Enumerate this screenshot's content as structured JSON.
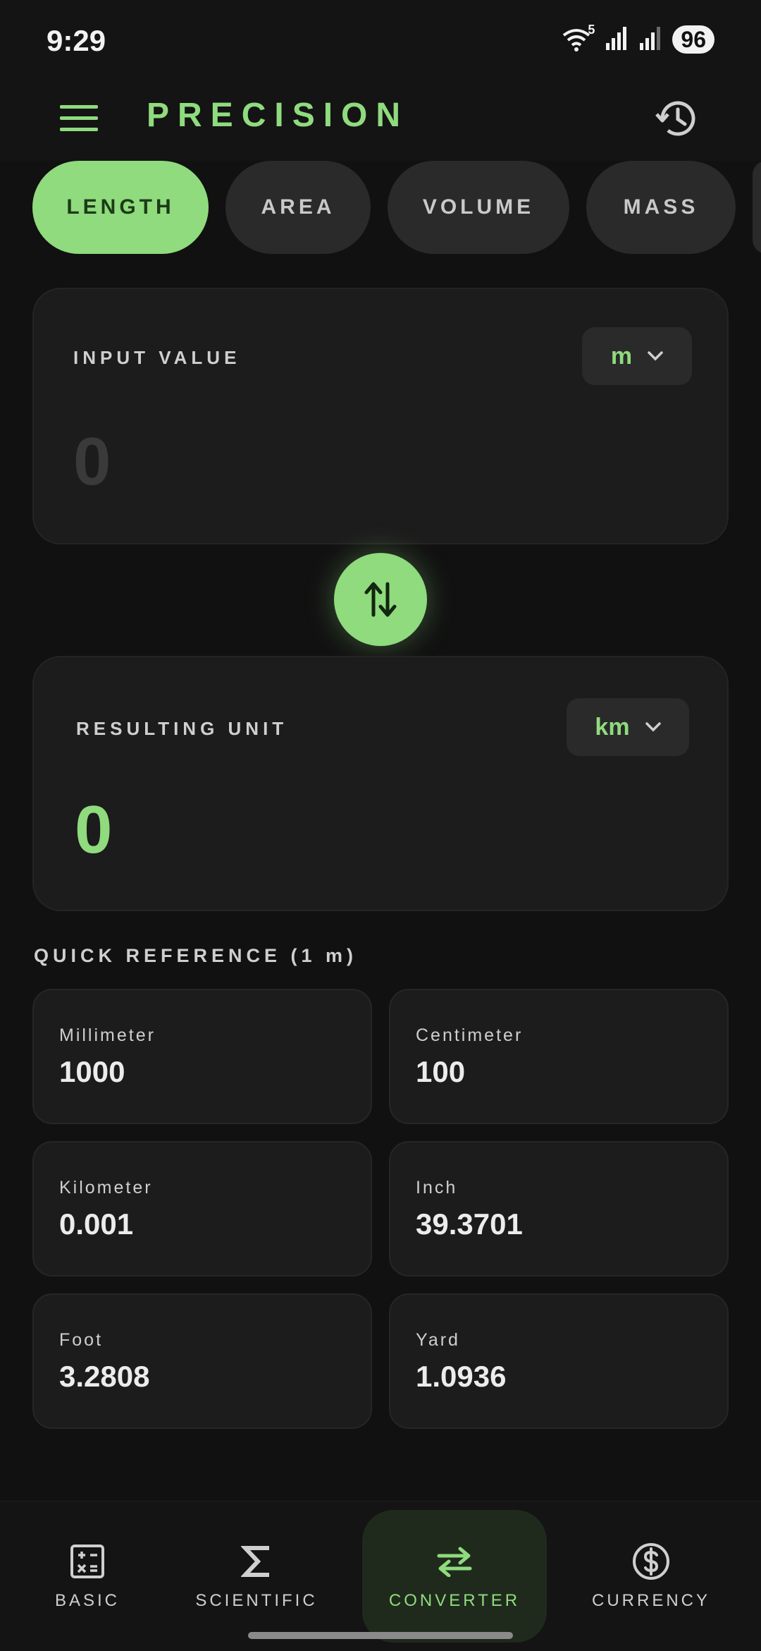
{
  "status": {
    "time": "9:29",
    "battery": "96",
    "wifi_badge": "5"
  },
  "app": {
    "title": "PRECISION"
  },
  "chips": [
    {
      "label": "LENGTH",
      "active": true
    },
    {
      "label": "AREA",
      "active": false
    },
    {
      "label": "VOLUME",
      "active": false
    },
    {
      "label": "MASS",
      "active": false
    }
  ],
  "input": {
    "label": "INPUT VALUE",
    "unit": "m",
    "value": "0"
  },
  "result": {
    "label": "RESULTING UNIT",
    "unit": "km",
    "value": "0"
  },
  "quick_reference": {
    "title": "QUICK REFERENCE (1 m)",
    "items": [
      {
        "name": "Millimeter",
        "value": "1000"
      },
      {
        "name": "Centimeter",
        "value": "100"
      },
      {
        "name": "Kilometer",
        "value": "0.001"
      },
      {
        "name": "Inch",
        "value": "39.3701"
      },
      {
        "name": "Foot",
        "value": "3.2808"
      },
      {
        "name": "Yard",
        "value": "1.0936"
      }
    ]
  },
  "nav": [
    {
      "label": "BASIC",
      "icon": "calculator-icon",
      "active": false
    },
    {
      "label": "SCIENTIFIC",
      "icon": "sigma-icon",
      "active": false
    },
    {
      "label": "CONVERTER",
      "icon": "swap-horizontal-icon",
      "active": true
    },
    {
      "label": "CURRENCY",
      "icon": "dollar-circle-icon",
      "active": false
    }
  ],
  "colors": {
    "accent": "#8fdb7e",
    "background": "#111111",
    "card": "#1c1c1c"
  }
}
